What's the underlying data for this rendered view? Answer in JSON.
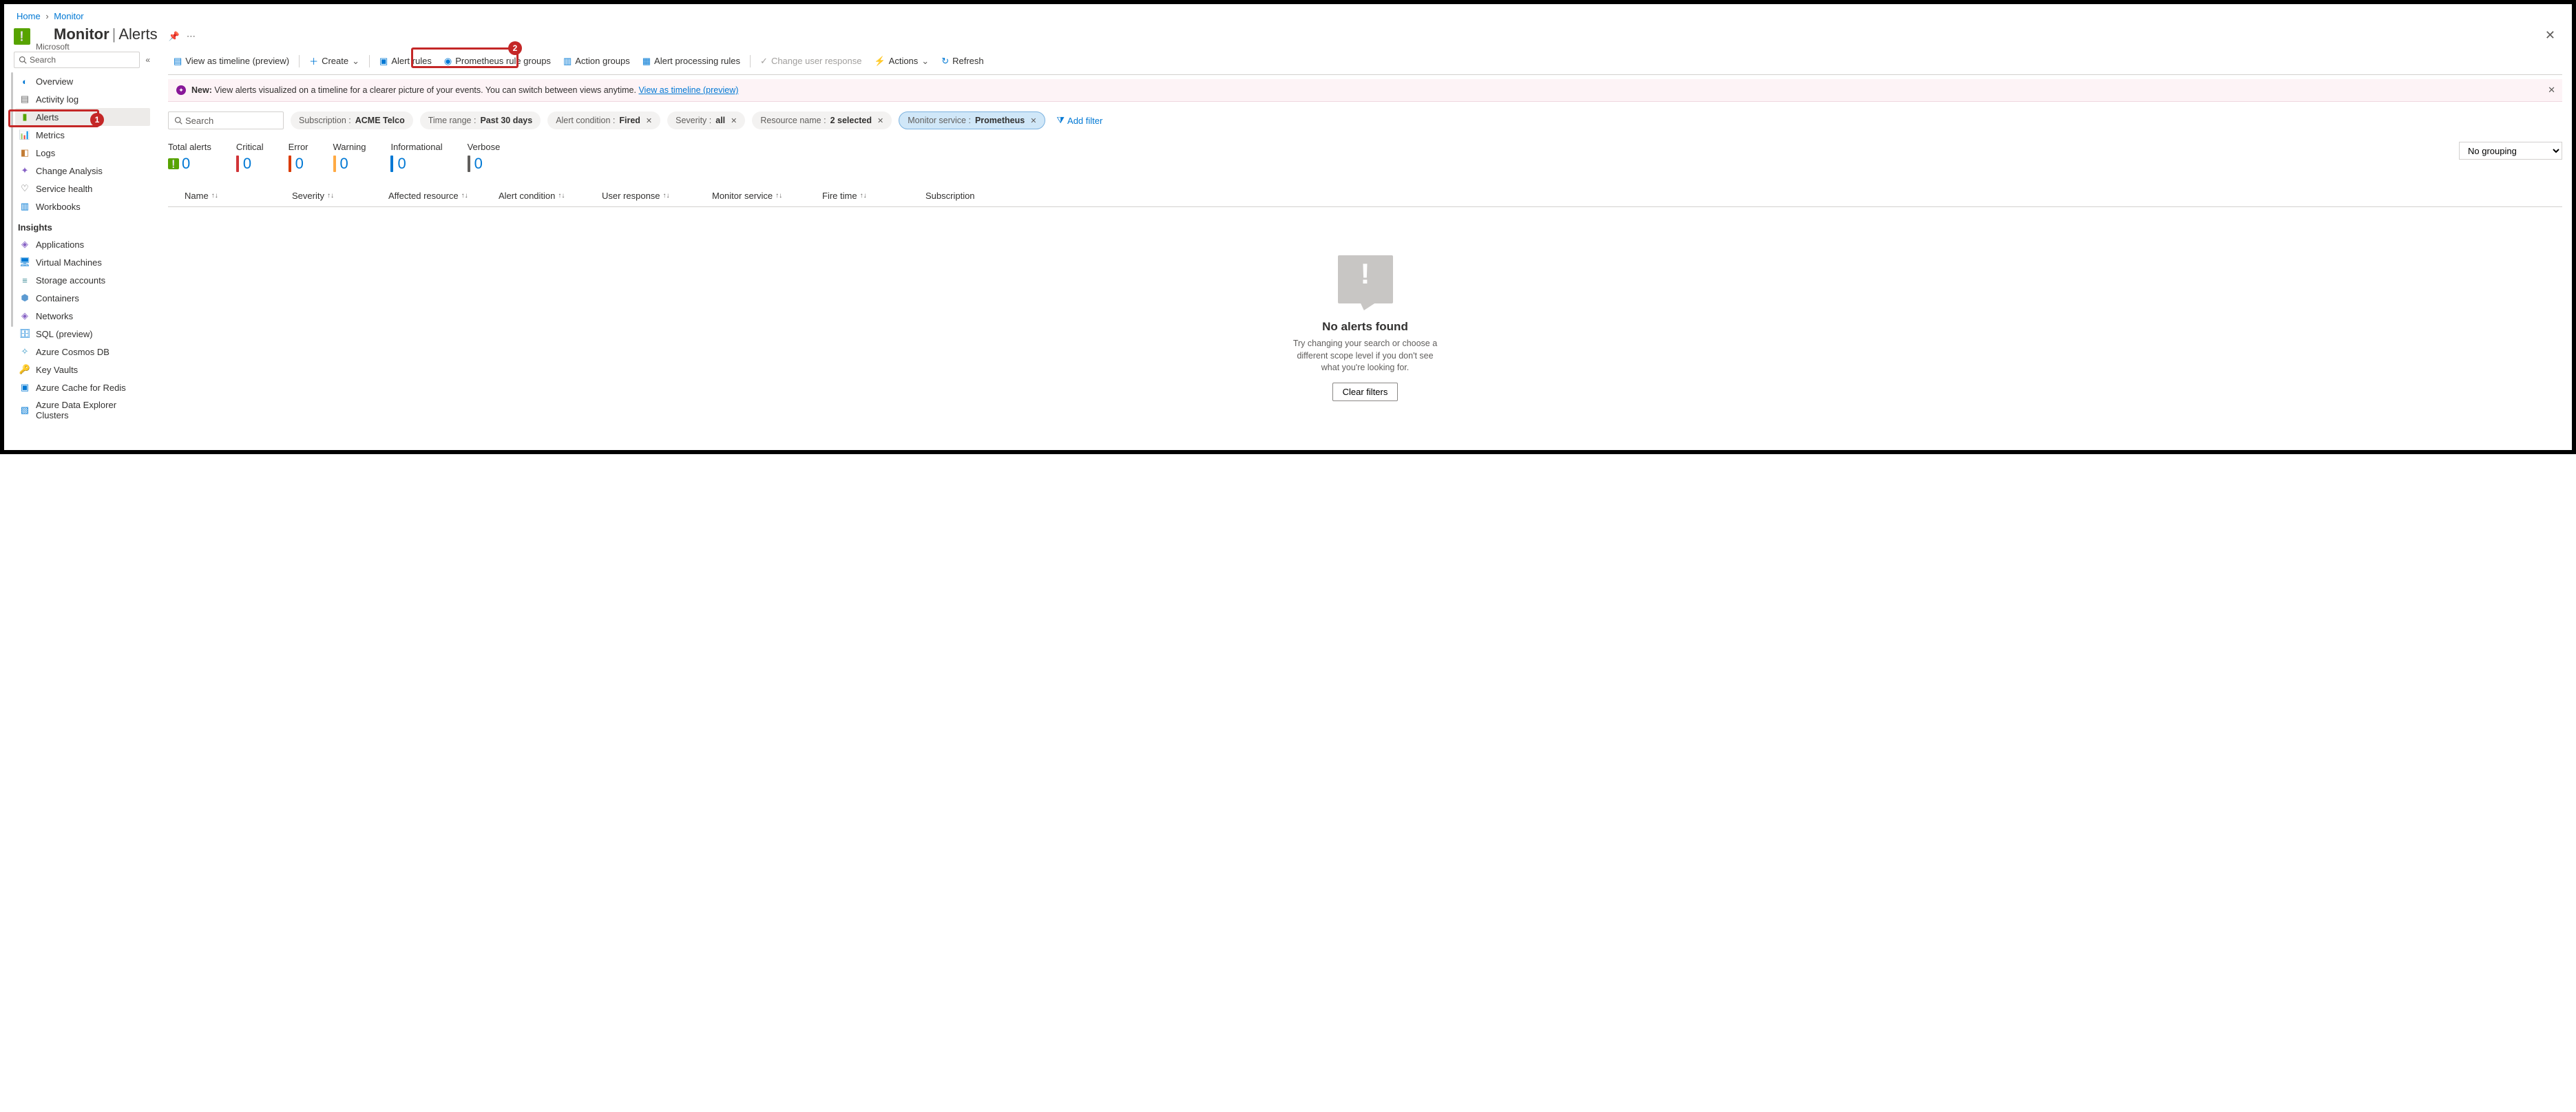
{
  "breadcrumb": {
    "items": [
      "Home",
      "Monitor"
    ]
  },
  "title": {
    "app": "Monitor",
    "page": "Alerts",
    "subtitle": "Microsoft"
  },
  "sidebar": {
    "search_placeholder": "Search",
    "items": [
      {
        "label": "Overview",
        "icon": "globe"
      },
      {
        "label": "Activity log",
        "icon": "activity"
      },
      {
        "label": "Alerts",
        "icon": "alerts",
        "selected": true
      },
      {
        "label": "Metrics",
        "icon": "metrics"
      },
      {
        "label": "Logs",
        "icon": "logs"
      },
      {
        "label": "Change Analysis",
        "icon": "change"
      },
      {
        "label": "Service health",
        "icon": "heart"
      },
      {
        "label": "Workbooks",
        "icon": "workbooks"
      }
    ],
    "group_label": "Insights",
    "insights": [
      {
        "label": "Applications",
        "icon": "app"
      },
      {
        "label": "Virtual Machines",
        "icon": "vm"
      },
      {
        "label": "Storage accounts",
        "icon": "storage"
      },
      {
        "label": "Containers",
        "icon": "containers"
      },
      {
        "label": "Networks",
        "icon": "networks"
      },
      {
        "label": "SQL (preview)",
        "icon": "sql"
      },
      {
        "label": "Azure Cosmos DB",
        "icon": "cosmos"
      },
      {
        "label": "Key Vaults",
        "icon": "keyvault"
      },
      {
        "label": "Azure Cache for Redis",
        "icon": "redis"
      },
      {
        "label": "Azure Data Explorer Clusters",
        "icon": "adx"
      }
    ]
  },
  "toolbar": {
    "view_timeline": "View as timeline (preview)",
    "create": "Create",
    "alert_rules": "Alert rules",
    "prometheus": "Prometheus rule groups",
    "action_groups": "Action groups",
    "processing_rules": "Alert processing rules",
    "change_user_response": "Change user response",
    "actions": "Actions",
    "refresh": "Refresh"
  },
  "banner": {
    "tag": "New:",
    "text": "View alerts visualized on a timeline for a clearer picture of your events. You can switch between views anytime.",
    "link": "View as timeline (preview)"
  },
  "filters": {
    "search_placeholder": "Search",
    "pills": [
      {
        "label": "Subscription : ",
        "value": "ACME Telco",
        "closable": false
      },
      {
        "label": "Time range : ",
        "value": "Past 30 days",
        "closable": false
      },
      {
        "label": "Alert condition : ",
        "value": "Fired",
        "closable": true
      },
      {
        "label": "Severity : ",
        "value": "all",
        "closable": true
      },
      {
        "label": "Resource name : ",
        "value": "2 selected",
        "closable": true
      },
      {
        "label": "Monitor service : ",
        "value": "Prometheus",
        "closable": true,
        "selected": true
      }
    ],
    "add_filter": "Add filter"
  },
  "stats": [
    {
      "label": "Total alerts",
      "value": "0",
      "color": "#57a300",
      "icon": true
    },
    {
      "label": "Critical",
      "value": "0",
      "color": "#d13438"
    },
    {
      "label": "Error",
      "value": "0",
      "color": "#da3b01"
    },
    {
      "label": "Warning",
      "value": "0",
      "color": "#ffaa44"
    },
    {
      "label": "Informational",
      "value": "0",
      "color": "#0078d4"
    },
    {
      "label": "Verbose",
      "value": "0",
      "color": "#605e5c"
    }
  ],
  "grouping": {
    "selected": "No grouping"
  },
  "columns": [
    "Name",
    "Severity",
    "Affected resource",
    "Alert condition",
    "User response",
    "Monitor service",
    "Fire time",
    "Subscription"
  ],
  "empty": {
    "title": "No alerts found",
    "text": "Try changing your search or choose a different scope level if you don't see what you're looking for.",
    "button": "Clear filters"
  },
  "callouts": {
    "1": "1",
    "2": "2"
  }
}
